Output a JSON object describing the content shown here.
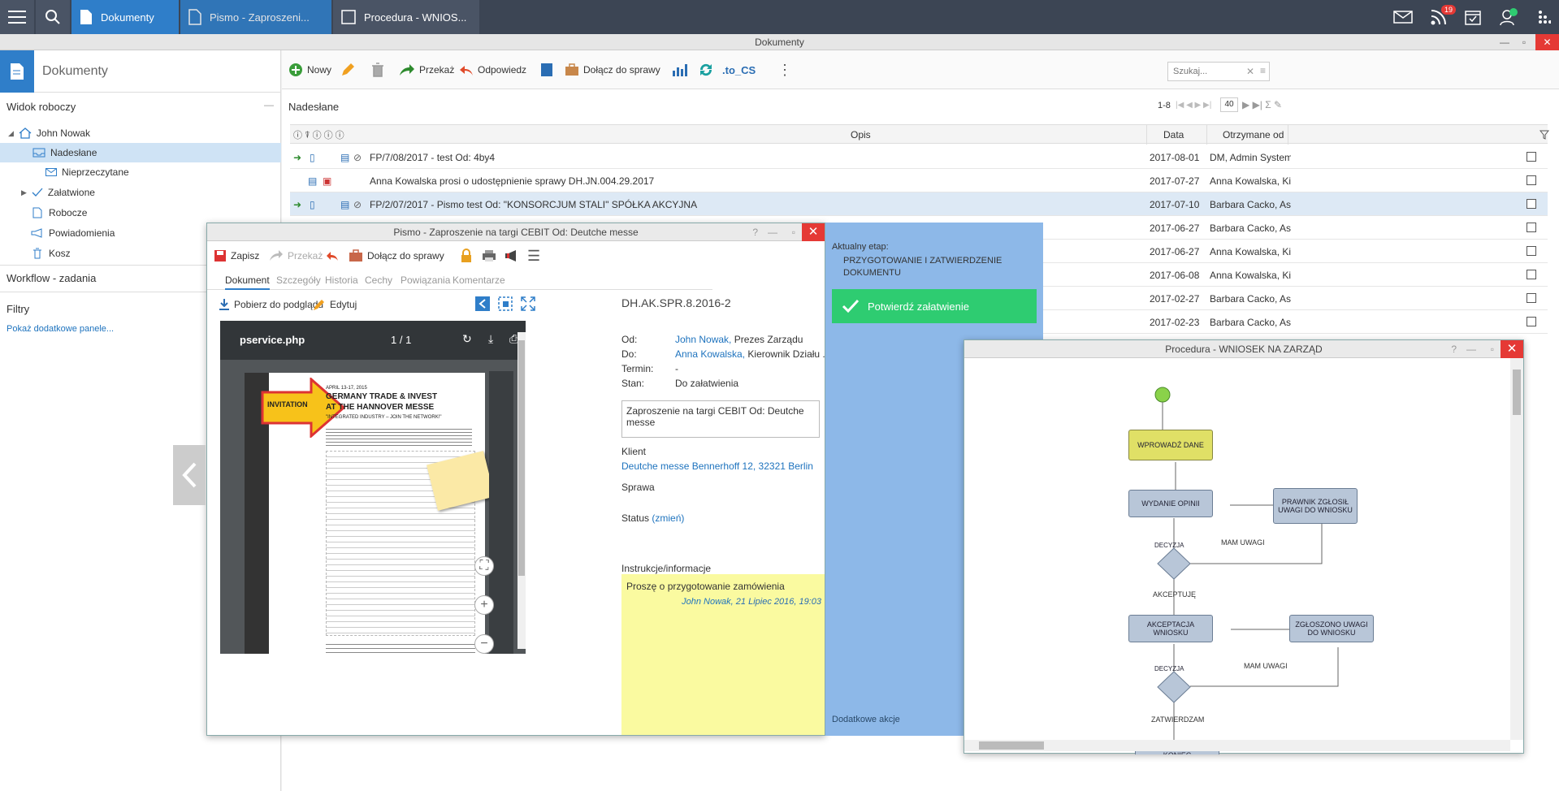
{
  "topbar": {
    "tabs": [
      {
        "label": "Dokumenty"
      },
      {
        "label": "Pismo - Zaproszeni..."
      },
      {
        "label": "Procedura - WNIOS..."
      }
    ],
    "rss_badge": "19"
  },
  "window": {
    "title": "Dokumenty"
  },
  "sidebar": {
    "title": "Dokumenty",
    "workspace_label": "Widok roboczy",
    "user": "John Nowak",
    "items": [
      {
        "label": "Nadesłane"
      },
      {
        "label": "Nieprzeczytane"
      },
      {
        "label": "Załatwione"
      },
      {
        "label": "Robocze"
      },
      {
        "label": "Powiadomienia"
      },
      {
        "label": "Kosz"
      }
    ],
    "workflow_label": "Workflow - zadania",
    "filters_label": "Filtry",
    "more_panels": "Pokaż dodatkowe panele..."
  },
  "toolbar": {
    "new": "Nowy",
    "forward": "Przekaż",
    "reply": "Odpowiedz",
    "attach": "Dołącz do sprawy",
    "tocs": ".to_CS",
    "search_placeholder": "Szukaj..."
  },
  "list": {
    "title": "Nadesłane",
    "range": "1-8",
    "page_size": "40",
    "columns": {
      "desc": "Opis",
      "date": "Data",
      "from": "Otrzymane od"
    },
    "rows": [
      {
        "desc": "FP/7/08/2017 - test Od: 4by4",
        "date": "2017-08-01",
        "from": "DM, Admin Systemu,"
      },
      {
        "desc": "Anna Kowalska prosi o udostępnienie sprawy DH.JN.004.29.2017",
        "date": "2017-07-27",
        "from": "Anna Kowalska, Kiero"
      },
      {
        "desc": "FP/2/07/2017 - Pismo test Od: \"KONSORCJUM STALI\" SPÓŁKA AKCYJNA",
        "date": "2017-07-10",
        "from": "Barbara Cacko, Asyst"
      },
      {
        "desc": "",
        "date": "2017-06-27",
        "from": "Barbara Cacko, Asyst"
      },
      {
        "desc": "",
        "date": "2017-06-27",
        "from": "Anna Kowalska, Kiero"
      },
      {
        "desc": "",
        "date": "2017-06-08",
        "from": "Anna Kowalska, Kiero"
      },
      {
        "desc": "",
        "date": "2017-02-27",
        "from": "Barbara Cacko, Asyst"
      },
      {
        "desc": "",
        "date": "2017-02-23",
        "from": "Barbara Cacko, Asyst"
      }
    ]
  },
  "pismo": {
    "title": "Pismo - Zaproszenie na targi CEBIT Od: Deutche messe",
    "save": "Zapisz",
    "forward": "Przekaż",
    "attach": "Dołącz do sprawy",
    "tabs": [
      "Dokument",
      "Szczegóły",
      "Historia",
      "Cechy",
      "Powiązania",
      "Komentarze"
    ],
    "download": "Pobierz do podglądu",
    "edit": "Edytuj",
    "pdf_name": "pservice.php",
    "pdf_page": "1",
    "pdf_total": "1",
    "doc_id": "DH.AK.SPR.8.2016-2",
    "from_label": "Od:",
    "from_name": "John Nowak,",
    "from_role": " Prezes Zarządu",
    "to_label": "Do:",
    "to_name": "Anna Kowalska,",
    "to_role": " Kierownik Działu ...",
    "term_label": "Termin:",
    "term_value": "-",
    "state_label": "Stan:",
    "state_value": "Do załatwienia",
    "subject": "Zaproszenie na targi CEBIT Od: Deutche messe",
    "client_label": "Klient",
    "client_value": "Deutche messe Bennerhoff 12, 32321 Berlin",
    "case_label": "Sprawa",
    "status_label": "Status",
    "status_change": "(zmień)",
    "instr_label": "Instrukcje/informacje",
    "instr_text": "Proszę o przygotowanie zamówienia",
    "instr_author": "John Nowak,",
    "instr_date": " 21 Lipiec 2016, 19:03",
    "flyer": {
      "invitation": "INVITATION",
      "date": "APRIL 13-17, 2015",
      "headline1": "GERMANY TRADE & INVEST",
      "headline2": "AT THE HANNOVER MESSE",
      "slogan": "\"INTEGRATED INDUSTRY – JOIN THE NETWORK!\""
    }
  },
  "stage": {
    "label": "Aktualny etap:",
    "value": "PRZYGOTOWANIE I ZATWIERDZENIE DOKUMENTU",
    "confirm": "Potwierdź załatwienie",
    "more": "Dodatkowe akcje"
  },
  "procedure": {
    "title": "Procedura - WNIOSEK NA ZARZĄD",
    "nodes": {
      "enter": "WPROWADŹ DANE",
      "opinion": "WYDANIE OPINII",
      "lawyer": "PRAWNIK ZGŁOSIŁ UWAGI DO WNIOSKU",
      "decision1": "DECYZJA",
      "accept": "AKCEPTACJA WNIOSKU",
      "reported": "ZGŁOSZONO UWAGI DO WNIOSKU",
      "decision2": "DECYZJA",
      "end": "KONIEC"
    },
    "edges": {
      "remarks1": "MAM UWAGI",
      "accepted": "AKCEPTUJĘ",
      "remarks2": "MAM UWAGI",
      "approve": "ZATWIERDZAM"
    }
  }
}
